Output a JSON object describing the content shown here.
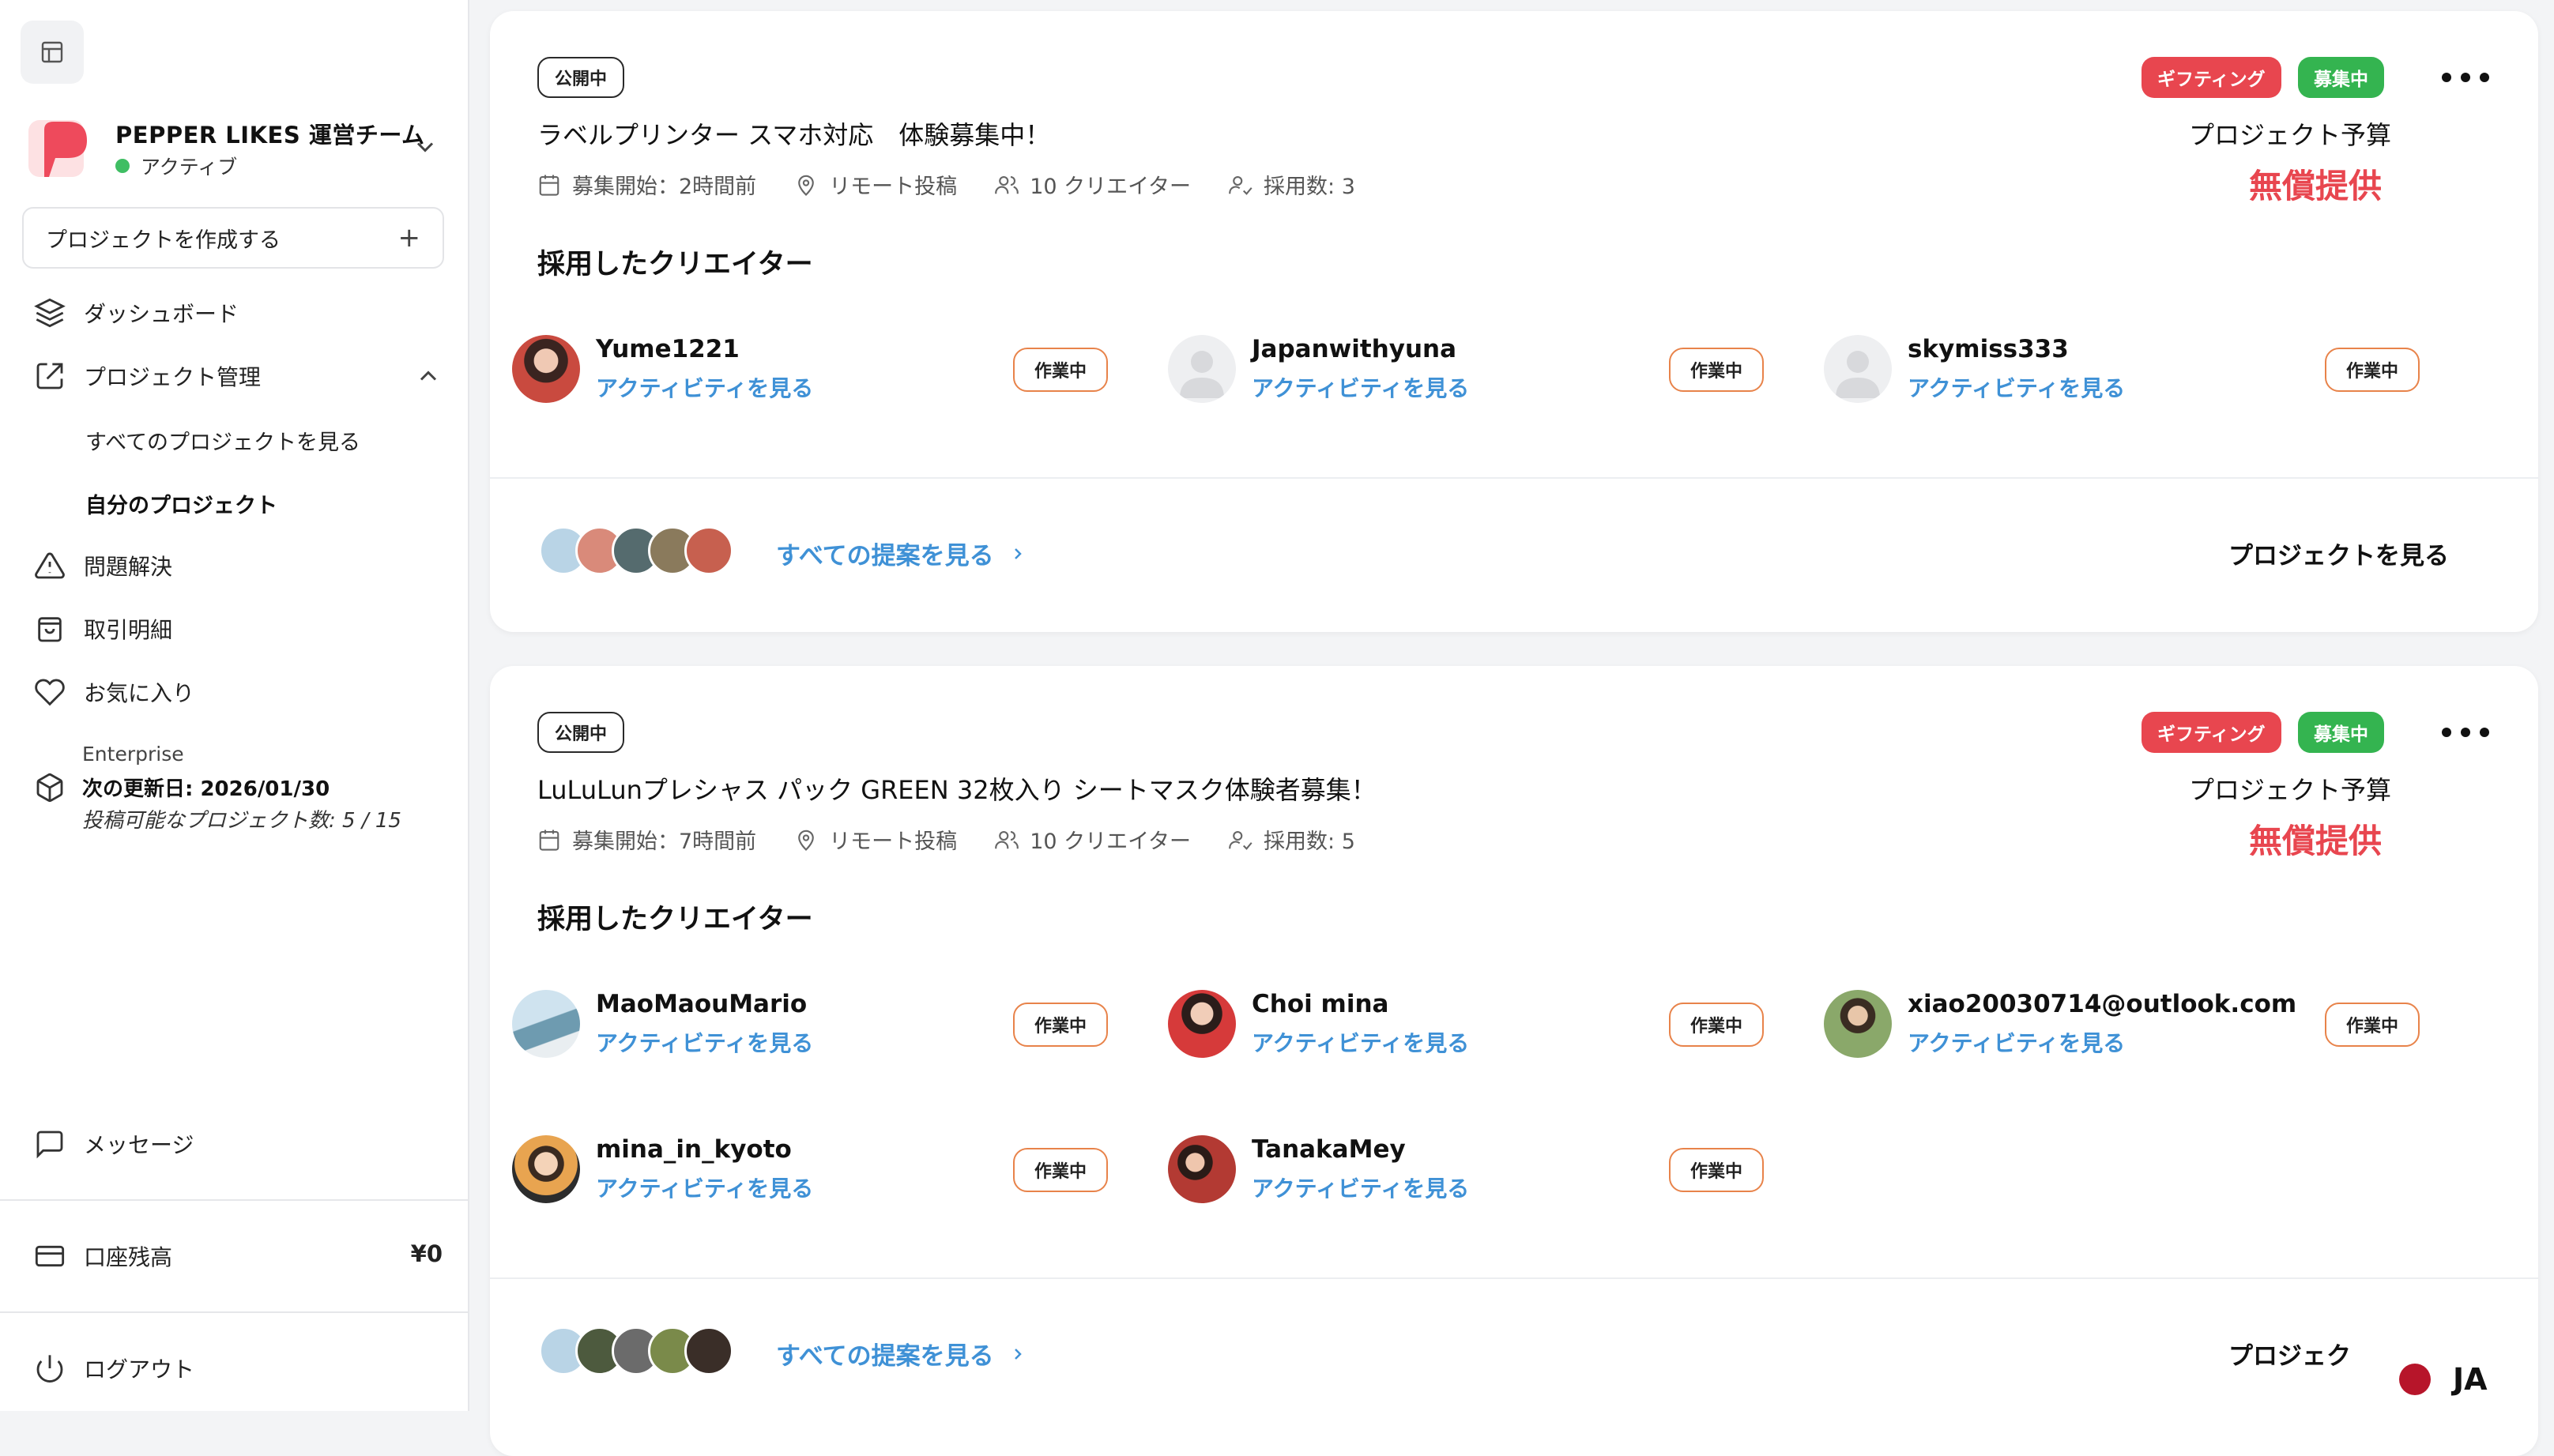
{
  "sidebar": {
    "team_name": "PEPPER LIKES 運営チーム",
    "team_status": "アクティブ",
    "create_label": "プロジェクトを作成する",
    "nav": {
      "dashboard": "ダッシュボード",
      "project_manage": "プロジェクト管理",
      "all_projects": "すべてのプロジェクトを見る",
      "my_projects": "自分のプロジェクト",
      "issues": "問題解決",
      "transactions": "取引明細",
      "favorites": "お気に入り"
    },
    "plan": {
      "name": "Enterprise",
      "renewal": "次の更新日: 2026/01/30",
      "count": "投稿可能なプロジェクト数: 5 / 15"
    },
    "messages": "メッセージ",
    "balance_label": "口座残高",
    "balance_value": "¥0",
    "logout": "ログアウト"
  },
  "projects": [
    {
      "status": "公開中",
      "tags": [
        "ギフティング",
        "募集中"
      ],
      "title": "ラベルプリンター スマホ対応　体験募集中！",
      "budget_label": "プロジェクト予算",
      "budget_value": "無償提供",
      "meta": {
        "start": "募集開始：2時間前",
        "location": "リモート投稿",
        "creators": "10 クリエイター",
        "hired": "採用数: 3"
      },
      "section_title": "採用したクリエイター",
      "hired_creators": [
        {
          "name": "Yume1221",
          "link": "アクティビティを見る",
          "status": "作業中"
        },
        {
          "name": "Japanwithyuna",
          "link": "アクティビティを見る",
          "status": "作業中"
        },
        {
          "name": "skymiss333",
          "link": "アクティビティを見る",
          "status": "作業中"
        }
      ],
      "see_all": "すべての提案を見る",
      "see_project": "プロジェクトを見る"
    },
    {
      "status": "公開中",
      "tags": [
        "ギフティング",
        "募集中"
      ],
      "title": "LuLuLunプレシャス パック GREEN 32枚入り シートマスク体験者募集！",
      "budget_label": "プロジェクト予算",
      "budget_value": "無償提供",
      "meta": {
        "start": "募集開始：7時間前",
        "location": "リモート投稿",
        "creators": "10 クリエイター",
        "hired": "採用数: 5"
      },
      "section_title": "採用したクリエイター",
      "hired_creators": [
        {
          "name": "MaoMaouMario",
          "link": "アクティビティを見る",
          "status": "作業中"
        },
        {
          "name": "Choi mina",
          "link": "アクティビティを見る",
          "status": "作業中"
        },
        {
          "name": "xiao20030714@outlook.com",
          "link": "アクティビティを見る",
          "status": "作業中"
        },
        {
          "name": "mina_in_kyoto",
          "link": "アクティビティを見る",
          "status": "作業中"
        },
        {
          "name": "TanakaMey",
          "link": "アクティビティを見る",
          "status": "作業中"
        }
      ],
      "see_all": "すべての提案を見る",
      "see_project": "プロジェク"
    }
  ],
  "language": "JA",
  "colors": {
    "accent_blue": "#3f91d6",
    "gift_red": "#e8464f",
    "recruit_green": "#34b450",
    "working_border": "#e8834a"
  }
}
